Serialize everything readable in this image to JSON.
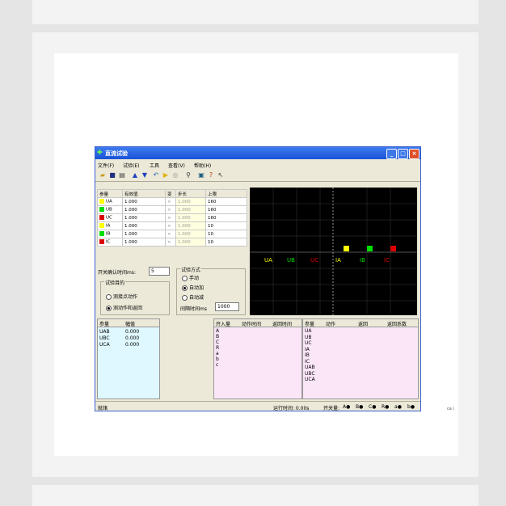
{
  "window": {
    "title": "直流试验"
  },
  "menu": [
    "文件(F)",
    "试验(E)",
    "工具",
    "查看(V)",
    "帮助(H)"
  ],
  "param_table": {
    "headers": [
      "参量",
      "有效值",
      "变",
      "步长",
      "上限"
    ],
    "rows": [
      {
        "name": "UA",
        "color": "#ffff00",
        "value": "1.000",
        "mark": "×",
        "step": "1.000",
        "limit": "160"
      },
      {
        "name": "UB",
        "color": "#00dd00",
        "value": "1.000",
        "mark": "×",
        "step": "1.000",
        "limit": "160"
      },
      {
        "name": "UC",
        "color": "#dd0000",
        "value": "1.000",
        "mark": "×",
        "step": "1.000",
        "limit": "160"
      },
      {
        "name": "IA",
        "color": "#ffff00",
        "value": "1.000",
        "mark": "×",
        "step": "1.000",
        "limit": "10"
      },
      {
        "name": "IB",
        "color": "#00dd00",
        "value": "1.000",
        "mark": "×",
        "step": "1.000",
        "limit": "10"
      },
      {
        "name": "IC",
        "color": "#dd0000",
        "value": "1.000",
        "mark": "×",
        "step": "1.000",
        "limit": "10"
      }
    ]
  },
  "scope": {
    "labels": [
      {
        "text": "UA",
        "color": "#ffff00"
      },
      {
        "text": "UB",
        "color": "#00dd00"
      },
      {
        "text": "UC",
        "color": "#dd0000"
      },
      {
        "text": "IA",
        "color": "#ffff00"
      },
      {
        "text": "IB",
        "color": "#00dd00"
      },
      {
        "text": "IC",
        "color": "#dd0000"
      }
    ]
  },
  "settings": {
    "confirm_label": "开关确认时间ms:",
    "confirm_value": "5",
    "purpose_title": "试验目的",
    "purpose_opt1": "测接点动作",
    "purpose_opt2": "测动作和返回",
    "mode_title": "试验方式",
    "mode_manual": "手动",
    "mode_auto_inc": "自动加",
    "mode_auto_dec": "自动减",
    "interval_label": "间隔时间ms",
    "interval_value": "1000"
  },
  "amp_table": {
    "headers": [
      "参量",
      "幅值"
    ],
    "rows": [
      {
        "name": "UAB",
        "value": "0.000"
      },
      {
        "name": "UBC",
        "value": "0.000"
      },
      {
        "name": "UCA",
        "value": "0.000"
      }
    ]
  },
  "switch_table": {
    "headers": [
      "开入量",
      "动作时间",
      "返回时间"
    ],
    "rows": [
      "A",
      "B",
      "C",
      "R",
      "a",
      "b",
      "c"
    ]
  },
  "result_table": {
    "headers": [
      "参量",
      "动作",
      "返回",
      "返回系数"
    ],
    "rows": [
      "UA",
      "UB",
      "UC",
      "IA",
      "IB",
      "IC",
      "UAB",
      "UBC",
      "UCA"
    ]
  },
  "status": {
    "ready": "就绪",
    "run_time": "运行时间: 0.00s",
    "switch_label": "开关量:",
    "switches": [
      "A",
      "B",
      "C",
      "R",
      "a",
      "b"
    ]
  },
  "side_caption": "ca i"
}
